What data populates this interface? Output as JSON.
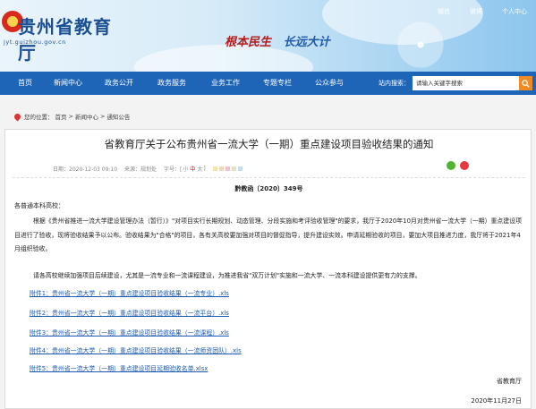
{
  "header": {
    "top_links": [
      "微信",
      "微博",
      "个人中心"
    ],
    "logo_title": "贵州省教育厅",
    "logo_url": "jyt.guizhou.gov.cn",
    "slogan_part1": "根本民生",
    "slogan_part2": "长远大计"
  },
  "nav": {
    "items": [
      "首页",
      "新闻中心",
      "政务公开",
      "政务服务",
      "业务工作",
      "专题专栏",
      "公众参与"
    ],
    "search_label": "站内搜索：",
    "search_placeholder": "请输入关键字搜索"
  },
  "breadcrumb": {
    "prefix": "您的位置：",
    "items": [
      "首页",
      "新闻中心",
      "通知公告"
    ],
    "separator": ">"
  },
  "article": {
    "title": "省教育厅关于公布贵州省一流大学（一期）重点建设项目验收结果的通知",
    "meta": {
      "date": "日期：2020-12-03 09:10",
      "source": "来源：规划处",
      "size_label": "字号：[",
      "sizes": [
        "小",
        "中",
        "大"
      ],
      "size_close": "]"
    },
    "doc_no": "黔教函〔2020〕349号",
    "greeting": "各普通本科高校：",
    "paragraph1": "根据《贵州省推进一流大学建设管理办法（暂行）》\"对项目实行长期规划、动态管理、分段实施和考评验收管理\"的要求，我厅于2020年10月对贵州省一流大学（一期）重点建设项目进行了验收，现将验收结果予以公布。验收结果为\"合格\"的项目，各有关高校要加强对项目的督促指导，提升建设实效。申请延期验收的项目，要加大项目推进力度，我厅将于2021年4月组织验收。",
    "paragraph2": "请各高校继续加强项目后续建设，尤其是一流专业和一流课程建设，为推进我省\"双万计划\"实施和一流大学、一流本科建设提供更有力的支撑。",
    "attachments": [
      "附件1：贵州省一流大学（一期）重点建设项目验收结果（一流专业）.xls",
      "附件2：贵州省一流大学（一期）重点建设项目验收结果（一流平台）.xls",
      "附件3：贵州省一流大学（一期）重点建设项目验收结果（一流课程）.xls",
      "附件4：贵州省一流大学（一期）重点建设项目验收结果（一流师资团队）.xls",
      "附件5：贵州省一流大学（一期）重点建设项目延期验收名单.xlsx"
    ],
    "signature": "省教育厅",
    "sign_date": "2020年11月27日"
  },
  "colors": {
    "nav_bg": "#1e64b7",
    "link": "#1a5ab6",
    "search_button": "#f08a24",
    "dot_colors": [
      "#f5e6a8",
      "#f3d7b8",
      "#f3c3c8",
      "#dce8c4",
      "#c8dde8"
    ]
  },
  "icons": {
    "share": [
      "wechat-icon",
      "weibo-icon"
    ],
    "search": "search-icon",
    "location": "location-pin-icon"
  }
}
